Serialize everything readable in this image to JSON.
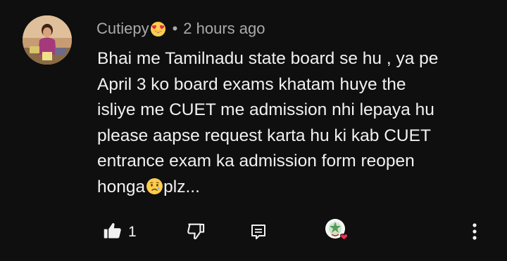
{
  "comment": {
    "author": "Cutiepy",
    "author_emoji": "heart-eyes-emoji",
    "separator": "•",
    "timestamp": "2 hours ago",
    "lines": [
      "Bhai me Tamilnadu state board se hu , ya pe",
      "April 3 ko board exams khatam huye the",
      "isliye me CUET me admission nhi lepaya hu",
      "please aapse request karta hu ki kab CUET",
      "entrance exam ka admission form reopen"
    ],
    "last_line_start": "honga",
    "last_line_emoji": "crying-face-emoji",
    "last_line_end": "plz..."
  },
  "actions": {
    "like_count": "1",
    "like_icon": "thumbs-up-icon",
    "dislike_icon": "thumbs-down-icon",
    "reply_icon": "reply-icon",
    "hearted_icon": "creator-heart-icon",
    "more_icon": "more-vert-icon"
  },
  "colors": {
    "background": "#0f0f0f",
    "text_primary": "#f1f1f1",
    "text_secondary": "#aaaaaa",
    "heart": "#ff2a4f"
  }
}
